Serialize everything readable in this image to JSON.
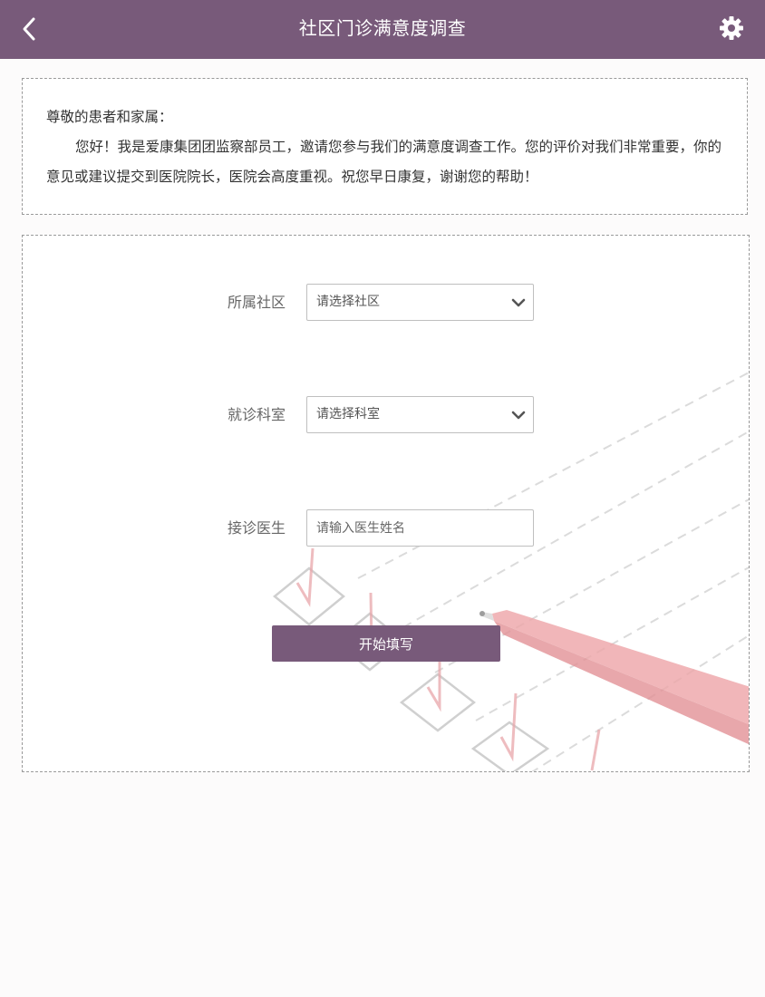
{
  "header": {
    "title": "社区门诊满意度调查",
    "bg_color": "#785a7a",
    "back_icon": "chevron-left-icon",
    "settings_icon": "gear-icon"
  },
  "intro": {
    "greeting": "尊敬的患者和家属：",
    "body": "您好！我是爱康集团团监察部员工，邀请您参与我们的满意度调查工作。您的评价对我们非常重要，你的意见或建议提交到医院院长，医院会高度重视。祝您早日康复，谢谢您的帮助！"
  },
  "form": {
    "community": {
      "label": "所属社区",
      "selected": "请选择社区",
      "icon": "chevron-down-icon"
    },
    "department": {
      "label": "就诊科室",
      "selected": "请选择科室",
      "icon": "chevron-down-icon"
    },
    "doctor": {
      "label": "接诊医生",
      "placeholder": "请输入医生姓名",
      "value": ""
    },
    "submit_label": "开始填写",
    "accent_color": "#785a7a"
  }
}
